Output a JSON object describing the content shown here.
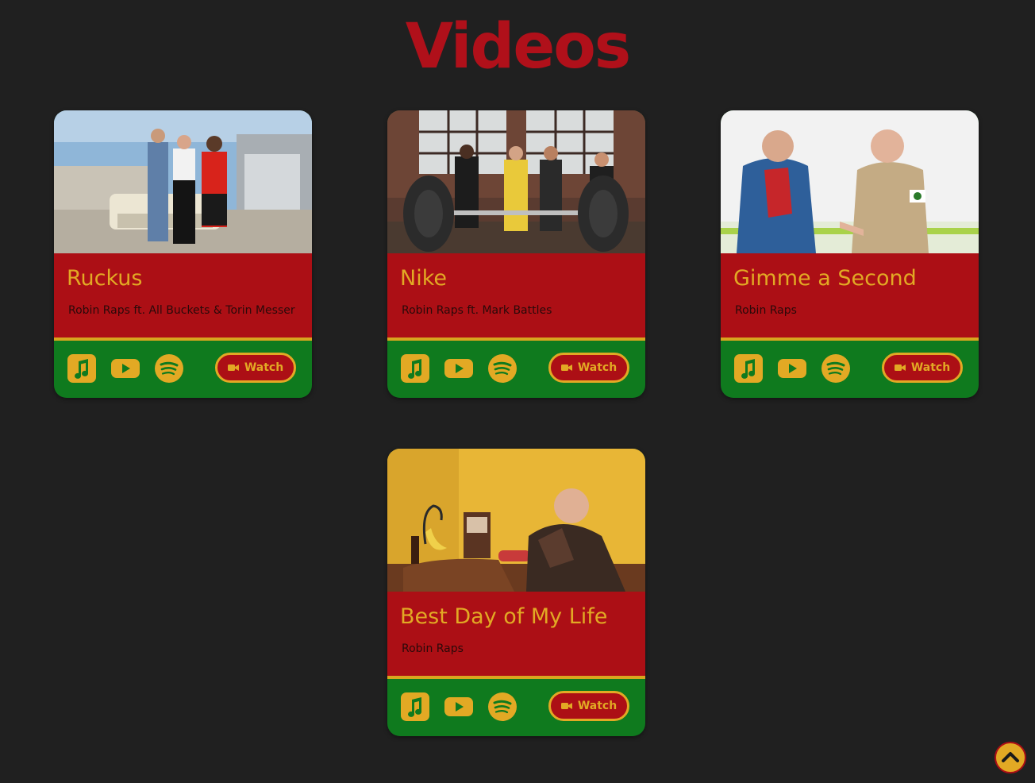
{
  "page": {
    "title": "Videos"
  },
  "colors": {
    "background": "#202020",
    "title_red": "#b0101a",
    "card_red": "#ac0f15",
    "card_green": "#0f7a1e",
    "accent_gold": "#e2a924"
  },
  "videos": [
    {
      "title": "Ruckus",
      "artist": "Robin Raps ft. All Buckets & Torin Messer",
      "watch_label": "Watch",
      "icons": [
        "apple-music-icon",
        "youtube-icon",
        "spotify-icon",
        "video-camera-icon"
      ]
    },
    {
      "title": "Nike",
      "artist": "Robin Raps ft. Mark Battles",
      "watch_label": "Watch",
      "icons": [
        "apple-music-icon",
        "youtube-icon",
        "spotify-icon",
        "video-camera-icon"
      ]
    },
    {
      "title": "Gimme a Second",
      "artist": "Robin Raps",
      "watch_label": "Watch",
      "icons": [
        "apple-music-icon",
        "youtube-icon",
        "spotify-icon",
        "video-camera-icon"
      ]
    },
    {
      "title": "Best Day of My Life",
      "artist": "Robin Raps",
      "watch_label": "Watch",
      "icons": [
        "apple-music-icon",
        "youtube-icon",
        "spotify-icon",
        "video-camera-icon"
      ]
    }
  ],
  "scroll_top": {
    "icon": "chevron-up-icon"
  }
}
